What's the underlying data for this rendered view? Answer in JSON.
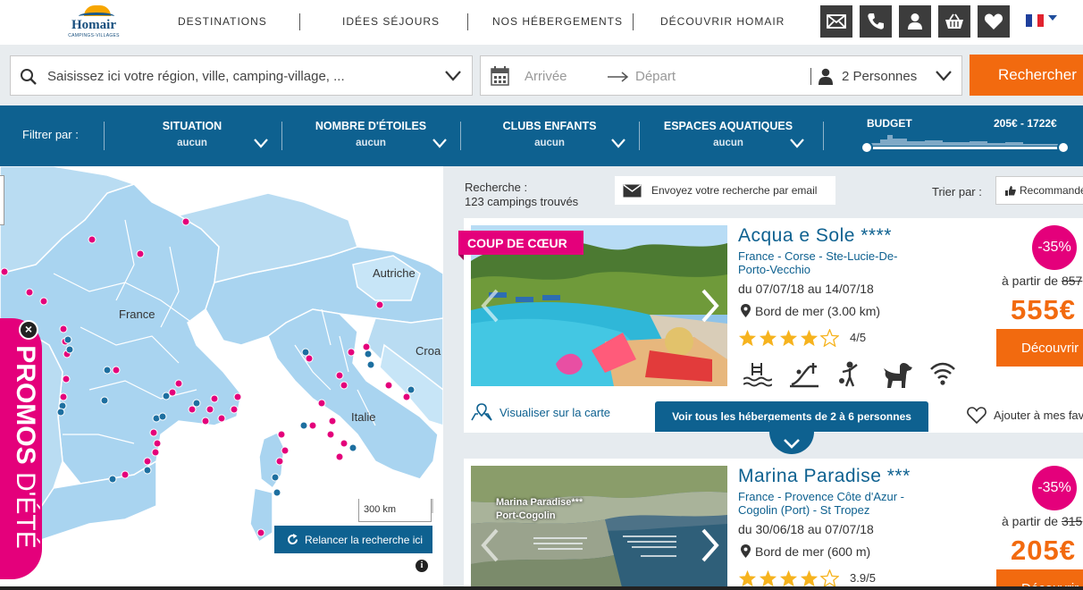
{
  "brand": {
    "name": "Homair",
    "subtitle": "CAMPINGS-VILLAGES"
  },
  "nav": [
    "DESTINATIONS",
    "IDÉES SÉJOURS",
    "NOS HÉBERGEMENTS",
    "DÉCOUVRIR HOMAIR"
  ],
  "header_icons": [
    "mail-icon",
    "phone-icon",
    "user-icon",
    "basket-icon",
    "heart-icon"
  ],
  "language": "FR",
  "search": {
    "destination_placeholder": "Saisissez ici votre région, ville, camping-village, ...",
    "arrival_placeholder": "Arrivée",
    "departure_placeholder": "Départ",
    "persons": "2 Personnes",
    "button": "Rechercher"
  },
  "filters": {
    "label": "Filtrer par :",
    "groups": [
      {
        "title": "SITUATION",
        "value": "aucun"
      },
      {
        "title": "NOMBRE D'ÉTOILES",
        "value": "aucun"
      },
      {
        "title": "CLUBS ENFANTS",
        "value": "aucun"
      },
      {
        "title": "ESPACES AQUATIQUES",
        "value": "aucun"
      }
    ],
    "budget_title": "BUDGET",
    "budget_range": "205€ - 1722€"
  },
  "map": {
    "labels": {
      "france": "France",
      "autriche": "Autriche",
      "italie": "Italie",
      "croatie": "Croa"
    },
    "scale": "300 km",
    "relaunch": "Relancer la recherche ici",
    "info": "i",
    "promo": {
      "bold": "PROMOS",
      "light": "D'ÉTÉ"
    }
  },
  "results": {
    "label": "Recherche :",
    "count": "123 campings trouvés",
    "email": "Envoyez votre recherche par email",
    "sort_label": "Trier par :",
    "sort_value": "Recommandé",
    "map_link": "Visualiser sur la carte",
    "see_all": "Voir tous les hébergements de 2 à 6 personnes",
    "add_fav": "Ajouter à mes favoris"
  },
  "cards": [
    {
      "tag": "COUP DE CŒUR",
      "name": "Acqua e Sole ****",
      "location_line1": "France - Corse - Ste-Lucie-De-",
      "location_line2": "Porto-Vecchio",
      "dates": "du 07/07/18 au 14/07/18",
      "sea": "Bord de mer (3.00 km)",
      "rating_value": 4,
      "rating": "4",
      "rating_max": "/5",
      "discount": "-35%",
      "from": "à partir de",
      "old_price": "857",
      "price": "555€",
      "cta": "Découvrir",
      "amenities": [
        "pool-icon",
        "slide-icon",
        "kids-club-icon",
        "dog-icon",
        "wifi-icon"
      ]
    },
    {
      "name": "Marina Paradise ***",
      "photo_label_1": "Marina Paradise***",
      "photo_label_2": "Port-Cogolin",
      "location_line1": "France - Provence Côte d'Azur -",
      "location_line2": "Cogolin (Port) - St Tropez",
      "dates": "du 30/06/18 au 07/07/18",
      "sea": "Bord de mer (600 m)",
      "rating_value": 3.9,
      "rating": "3.9",
      "rating_max": "/5",
      "discount": "-35%",
      "from": "à partir de",
      "old_price": "315",
      "price": "205€",
      "cta": "Découvrir"
    }
  ],
  "colors": {
    "blue": "#0e6190",
    "orange": "#f26a0f",
    "pink": "#e4007b",
    "map_land": "#a9d4f0"
  }
}
